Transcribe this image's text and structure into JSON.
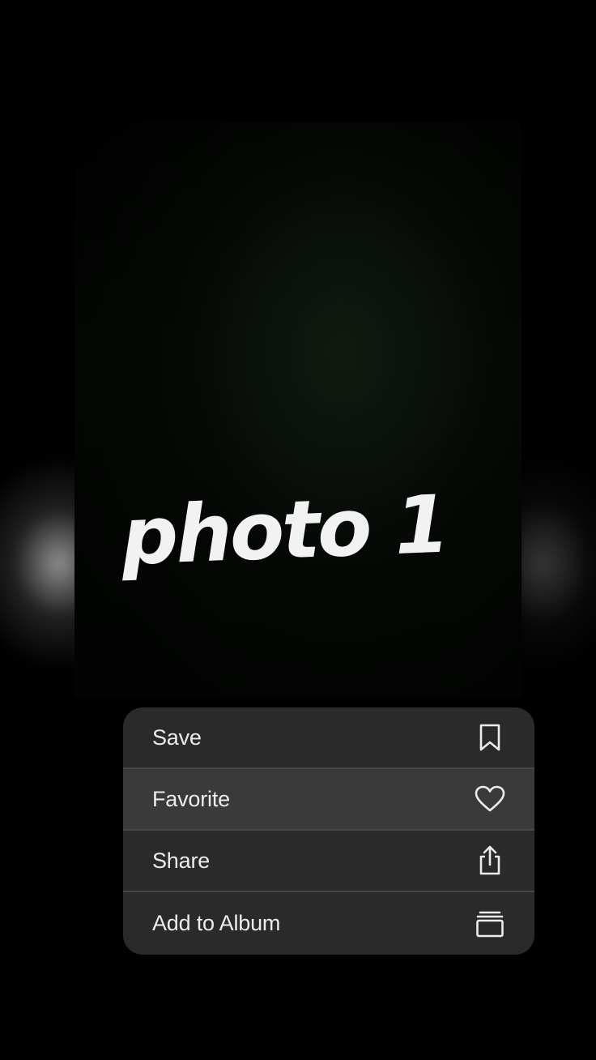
{
  "preview": {
    "caption": "photo 1"
  },
  "menu": {
    "items": [
      {
        "label": "Save",
        "icon": "bookmark-icon",
        "highlighted": false
      },
      {
        "label": "Favorite",
        "icon": "heart-icon",
        "highlighted": true
      },
      {
        "label": "Share",
        "icon": "share-icon",
        "highlighted": false
      },
      {
        "label": "Add to Album",
        "icon": "album-stack-icon",
        "highlighted": false
      }
    ]
  },
  "colors": {
    "background": "#000000",
    "menu_background": "#2a2a2a",
    "menu_highlight": "#3a3a3a",
    "menu_divider": "#474747",
    "text": "#ececec"
  }
}
